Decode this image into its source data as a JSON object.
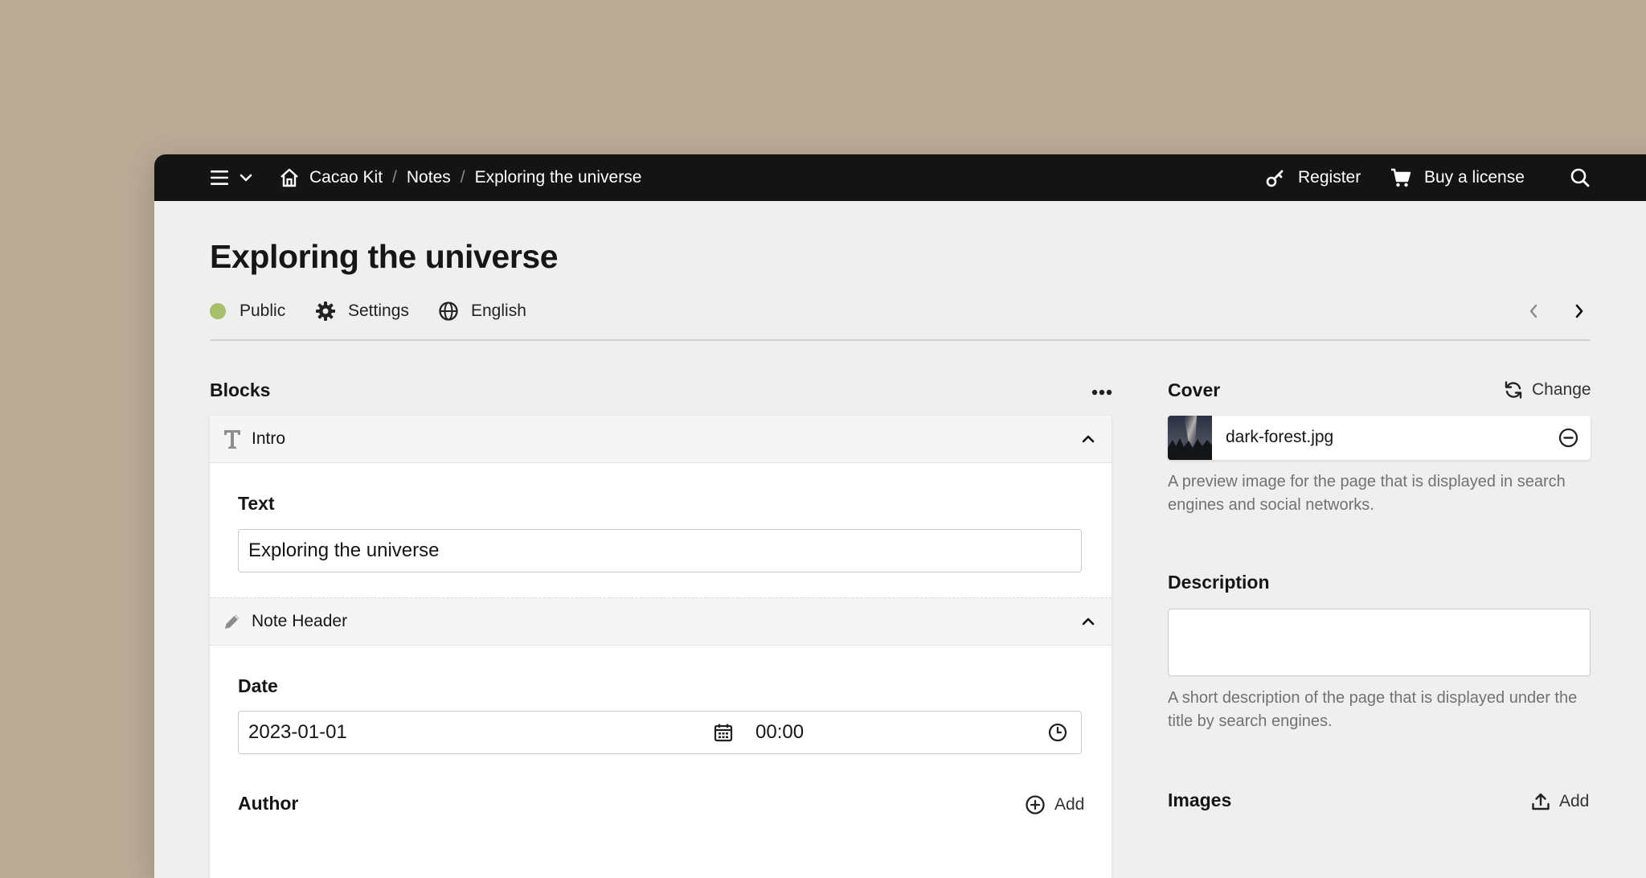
{
  "topbar": {
    "site": "Cacao Kit",
    "crumbs": [
      "Notes",
      "Exploring the universe"
    ],
    "register": "Register",
    "buy": "Buy a license"
  },
  "page": {
    "title": "Exploring the universe",
    "status": "Public",
    "status_color": "#a7bf6a",
    "settings": "Settings",
    "language": "English"
  },
  "blocks": {
    "label": "Blocks",
    "items": [
      {
        "title": "Intro",
        "icon": "text-icon",
        "field_label": "Text",
        "field_value": "Exploring the universe"
      },
      {
        "title": "Note Header",
        "icon": "pencil-icon",
        "field_label": "Date",
        "date_value": "2023-01-01",
        "time_value": "00:00",
        "author_label": "Author",
        "author_add": "Add"
      }
    ]
  },
  "sidebar": {
    "cover_label": "Cover",
    "cover_action": "Change",
    "cover_file": "dark-forest.jpg",
    "cover_help": "A preview image for the page that is displayed in search engines and social networks.",
    "description_label": "Description",
    "description_value": "",
    "description_help": "A short description of the page that is displayed under the title by search engines.",
    "images_label": "Images",
    "images_add": "Add"
  }
}
